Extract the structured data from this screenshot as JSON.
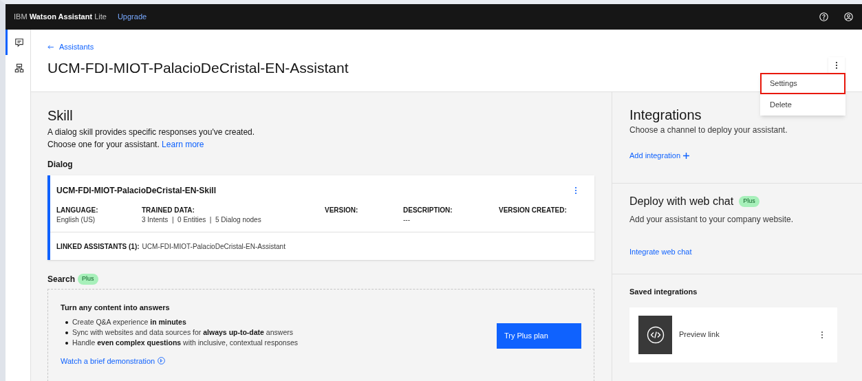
{
  "header": {
    "brand_prefix": "IBM",
    "brand_name": "Watson Assistant",
    "brand_suffix": "Lite",
    "upgrade": "Upgrade"
  },
  "rail": [
    {
      "kind": "chat",
      "selected": true
    },
    {
      "kind": "flow",
      "selected": false
    }
  ],
  "breadcrumb": "Assistants",
  "title": "UCM-FDI-MIOT-PalacioDeCristal-EN-Assistant",
  "overflow_menu": {
    "items": [
      {
        "label": "Settings",
        "highlighted": true
      },
      {
        "label": "Delete",
        "highlighted": false
      }
    ]
  },
  "skill": {
    "title": "Skill",
    "description": "A dialog skill provides specific responses you've created.",
    "description2": "Choose one for your assistant.",
    "learn_more": "Learn more",
    "dialog_label": "Dialog",
    "card": {
      "name": "UCM-FDI-MIOT-PalacioDeCristal-EN-Skill",
      "fields": [
        {
          "label": "LANGUAGE:",
          "value": "English (US)"
        },
        {
          "label": "TRAINED DATA:",
          "value": "3 Intents  |  0 Entities  |  5 Dialog nodes"
        },
        {
          "label": "VERSION:"
        },
        {
          "label": "DESCRIPTION:",
          "value": "---"
        },
        {
          "label": "VERSION CREATED:"
        }
      ],
      "linked_label": "LINKED ASSISTANTS (1):",
      "linked_value": "UCM-FDI-MIOT-PalacioDeCristal-EN-Assistant"
    }
  },
  "search": {
    "title": "Search",
    "badge": "Plus",
    "heading": "Turn any content into answers",
    "bullets": [
      "Create Q&A experience **in minutes**",
      "Sync with websites and data sources for **always up-to-date** answers",
      "Handle **even complex questions** with inclusive, contextual responses"
    ],
    "watch_link": "Watch a brief demonstration",
    "button": "Try Plus plan"
  },
  "integrations": {
    "title": "Integrations",
    "description": "Choose a channel to deploy your assistant.",
    "add": "Add integration"
  },
  "web_chat": {
    "title": "Deploy with web chat",
    "badge": "Plus",
    "description": "Add your assistant to your company website.",
    "link": "Integrate web chat"
  },
  "saved": {
    "title": "Saved integrations",
    "items": [
      {
        "label": "Preview link"
      }
    ]
  }
}
